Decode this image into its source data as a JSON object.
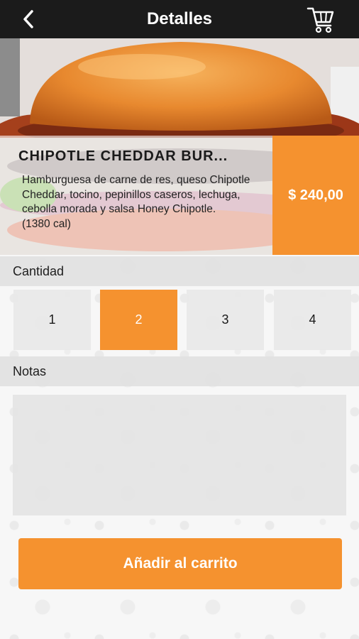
{
  "header": {
    "title": "Detalles",
    "back_icon": "chevron-left-icon",
    "cart_icon": "cart-icon"
  },
  "product": {
    "name": "CHIPOTLE CHEDDAR BUR...",
    "description": "Hamburguesa de carne de res, queso Chipotle Cheddar, tocino, pepinillos caseros, lechuga, cebolla morada y salsa Honey Chipotle.",
    "calories": "(1380 cal)",
    "price": "$ 240,00"
  },
  "quantity": {
    "label": "Cantidad",
    "options": [
      "1",
      "2",
      "3",
      "4"
    ],
    "selected": "2"
  },
  "notes": {
    "label": "Notas",
    "value": ""
  },
  "actions": {
    "add_to_cart": "Añadir al carrito"
  },
  "colors": {
    "accent": "#f5922f",
    "header": "#1b1b1b"
  }
}
